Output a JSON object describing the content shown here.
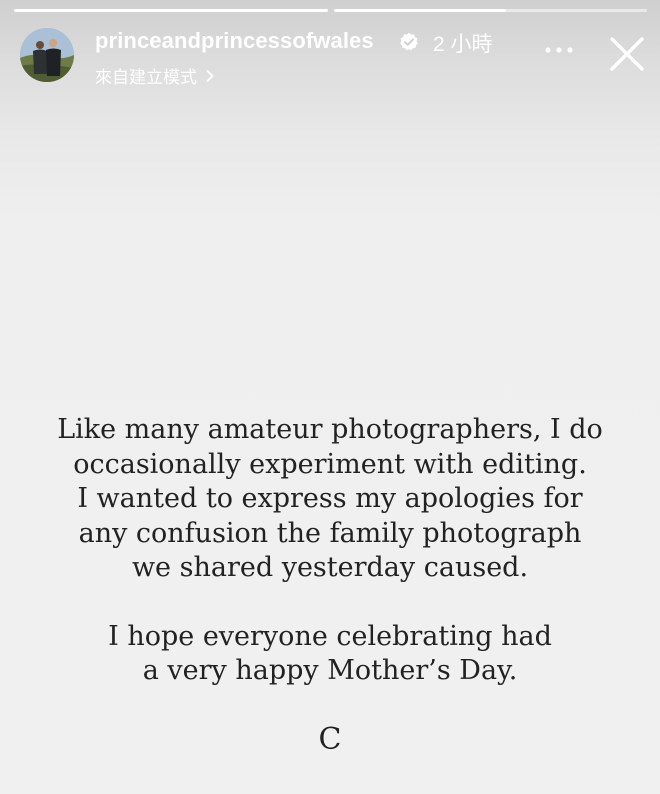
{
  "story": {
    "progress": [
      {
        "fill": 1.0
      },
      {
        "fill": 0.55
      }
    ],
    "header": {
      "username": "princeandprincessofwales",
      "timestamp": "2 小時",
      "subtitle": "來自建立模式"
    },
    "icons": {
      "verified": "verified-badge-icon",
      "more": "more-options-icon",
      "close": "close-icon",
      "chevron": "chevron-right-icon"
    },
    "message": {
      "paragraph_1_lines": [
        "Like many amateur photographers, I do",
        "occasionally experiment with editing.",
        "I wanted to express my apologies for",
        "any confusion the family photograph",
        "we shared yesterday caused."
      ],
      "paragraph_2_lines": [
        "I hope everyone celebrating had",
        "a very happy Mother’s Day."
      ],
      "signature": "C"
    }
  },
  "colors": {
    "background": "#f0f0f0",
    "text": "#222222",
    "header_text": "#ffffff"
  }
}
